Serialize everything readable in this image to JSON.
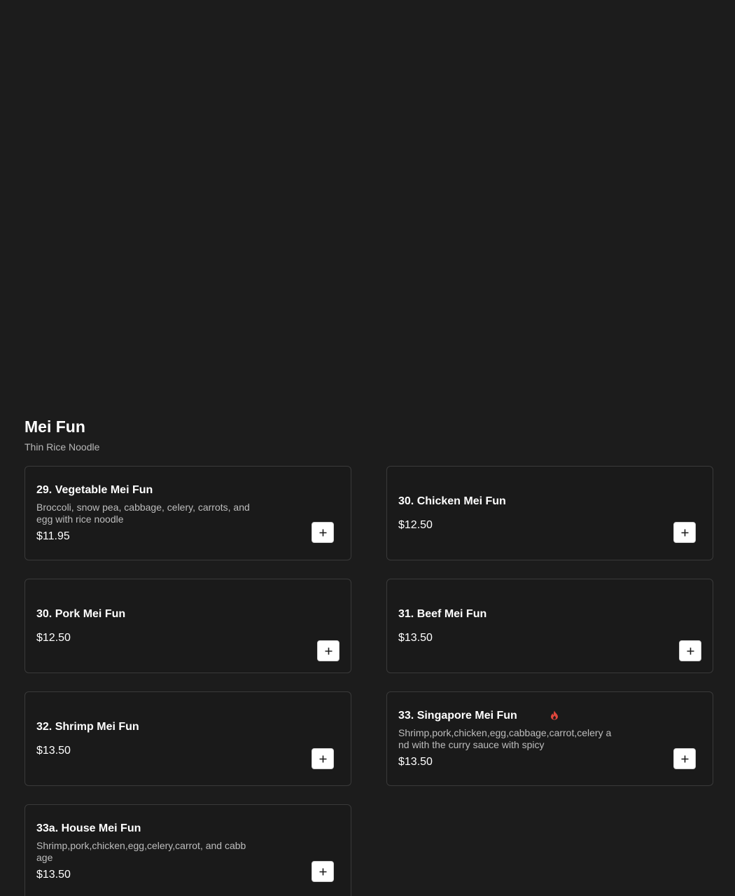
{
  "section": {
    "title": "Mei Fun",
    "subtitle": "Thin Rice Noodle"
  },
  "items": [
    {
      "name": "29. Vegetable Mei Fun",
      "description": "Broccoli, snow pea, cabbage, celery, carrots, and egg with rice noodle",
      "price": "$11.95"
    },
    {
      "name": "30. Chicken Mei Fun",
      "description": "",
      "price": "$12.50"
    },
    {
      "name": "30. Pork Mei Fun",
      "description": "",
      "price": "$12.50"
    },
    {
      "name": "31. Beef Mei Fun",
      "description": "",
      "price": "$13.50"
    },
    {
      "name": "32. Shrimp Mei Fun",
      "description": "",
      "price": "$13.50"
    },
    {
      "name": "33. Singapore Mei Fun",
      "description": "Shrimp,pork,chicken,egg,cabbage,carrot,celery and with the curry sauce with spicy",
      "price": "$13.50",
      "icon": "spicy-flame-icon",
      "icon_color": "#e0463c"
    },
    {
      "name": "33a. House Mei Fun",
      "description": "Shrimp,pork,chicken,egg,celery,carrot, and cabbage",
      "price": "$13.50"
    }
  ],
  "add_button_icon": "plus-icon",
  "colors": {
    "background": "#1c1c1c",
    "card_border": "#3a3a3a",
    "button_bg": "#ffffff",
    "spicy": "#e0463c"
  }
}
